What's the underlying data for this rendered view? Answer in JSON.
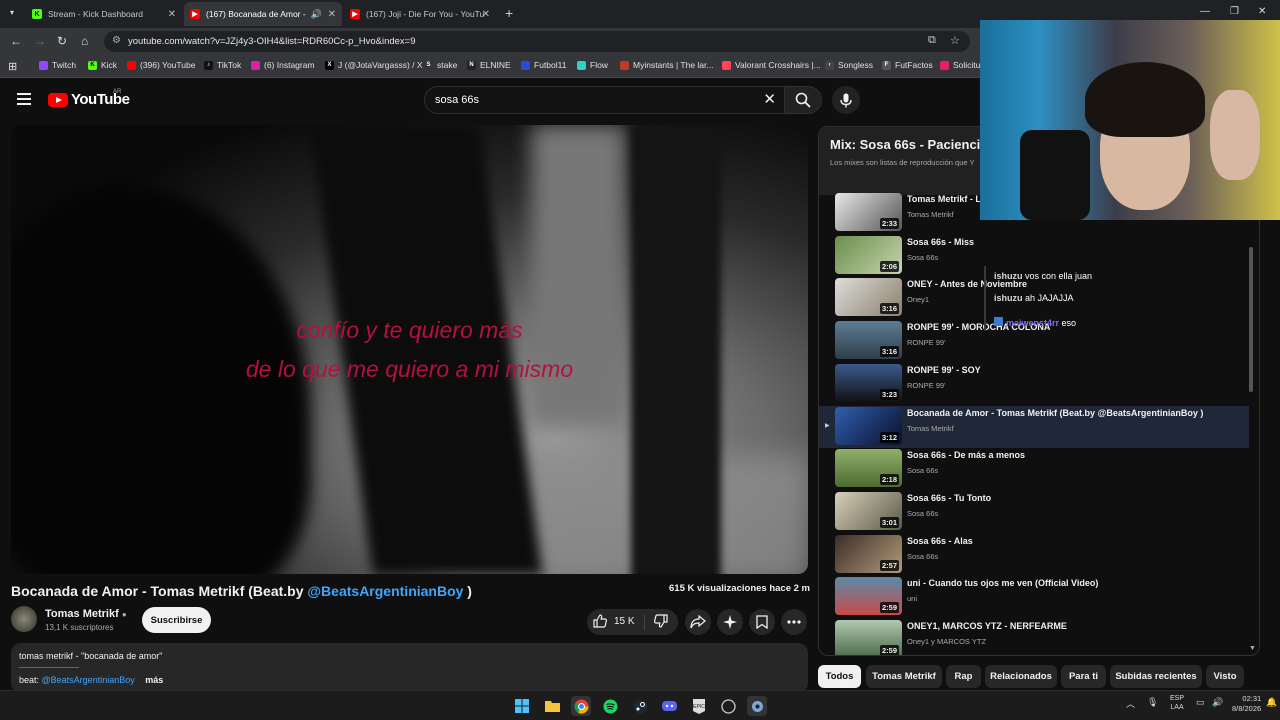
{
  "browser": {
    "tabs": [
      {
        "label": "Stream - Kick Dashboard",
        "active": false
      },
      {
        "label": "(167) Bocanada de Amor - ",
        "active": true
      },
      {
        "label": "(167) Joji - Die For You - YouTu",
        "active": false
      }
    ],
    "url": "youtube.com/watch?v=JZj4y3-OIH4&list=RDR60Cc-p_Hvo&index=9",
    "bookmarks": [
      "Twitch",
      "Kick",
      "(396) YouTube",
      "TikTok",
      "(6) Instagram",
      "J (@JotaVargasss) / X",
      "stake",
      "ELNINE",
      "Futbol11",
      "Flow",
      "Myinstants | The lar...",
      "Valorant Crosshairs |...",
      "Songless",
      "FutFactos",
      "Solicitu"
    ]
  },
  "youtube": {
    "country": "AR",
    "logo_text": "YouTube",
    "search_value": "sosa 66s",
    "lyrics": [
      "confío y te quiero más",
      "de lo que me quiero a mi mismo"
    ],
    "video": {
      "title_prefix": "Bocanada de Amor - Tomas Metrikf (Beat.by ",
      "title_link": "@BeatsArgentinianBoy",
      "title_suffix": " )",
      "views": "615 K visualizaciones  hace 2 m",
      "channel": "Tomas Metrikf",
      "subscribers": "13,1 K suscriptores",
      "subscribe_label": "Suscribirse",
      "likes": "15 K",
      "desc_line1": "tomas metrikf - \"bocanada de amor\"",
      "desc_beat": "beat: ",
      "desc_beat_link": "@BeatsArgentinianBoy",
      "desc_more": "más"
    },
    "playlist": {
      "title": "Mix: Sosa 66s - Paciencia",
      "subtitle": "Los mixes son listas de reproducción que Y",
      "items": [
        {
          "title": "Tomas Metrikf - L",
          "artist": "Tomas Metrikf",
          "duration": "2:33",
          "current": false
        },
        {
          "title": "Sosa 66s - Miss",
          "artist": "Sosa 66s",
          "duration": "2:06",
          "current": false
        },
        {
          "title": "ONEY - Antes de Noviembre",
          "artist": "Oney1",
          "duration": "3:16",
          "current": false
        },
        {
          "title": "RONPE 99' - MOROCHA COLONA",
          "artist": "RONPE 99'",
          "duration": "3:16",
          "current": false
        },
        {
          "title": "RONPE 99' - SOY",
          "artist": "RONPE 99'",
          "duration": "3:23",
          "current": false
        },
        {
          "title": "Bocanada de Amor - Tomas Metrikf (Beat.by @BeatsArgentinianBoy )",
          "artist": "Tomas Metrikf",
          "duration": "3:12",
          "current": true
        },
        {
          "title": "Sosa 66s - De más a menos",
          "artist": "Sosa 66s",
          "duration": "2:18",
          "current": false
        },
        {
          "title": "Sosa 66s - Tu Tonto",
          "artist": "Sosa 66s",
          "duration": "3:01",
          "current": false
        },
        {
          "title": "Sosa 66s - Alas",
          "artist": "Sosa 66s",
          "duration": "2:57",
          "current": false
        },
        {
          "title": "uni - Cuando tus ojos me ven (Official Video)",
          "artist": "uni",
          "duration": "2:59",
          "current": false
        },
        {
          "title": "ONEY1, MARCOS YTZ - NERFEARME",
          "artist": "Oney1 y MARCOS YTZ",
          "duration": "2:59",
          "current": false
        }
      ]
    },
    "chips": [
      "Todos",
      "Tomas Metrikf",
      "Rap",
      "Relacionados",
      "Para ti",
      "Subidas recientes",
      "Visto"
    ]
  },
  "stream_chat": [
    {
      "user": "ishuzu",
      "text": "vos con ella juan"
    },
    {
      "user": "ishuzu",
      "text": "ah JAJAJJA"
    },
    {
      "user": "maiwenst4rr",
      "text": "eso"
    }
  ],
  "taskbar": {
    "lang": "ESP",
    "region": "LAA",
    "time": "02:31",
    "date": "8/8/2026"
  },
  "colors": {
    "accent_red": "#ff0000",
    "link_blue": "#3ea6ff",
    "lyric": "#b5103e"
  }
}
